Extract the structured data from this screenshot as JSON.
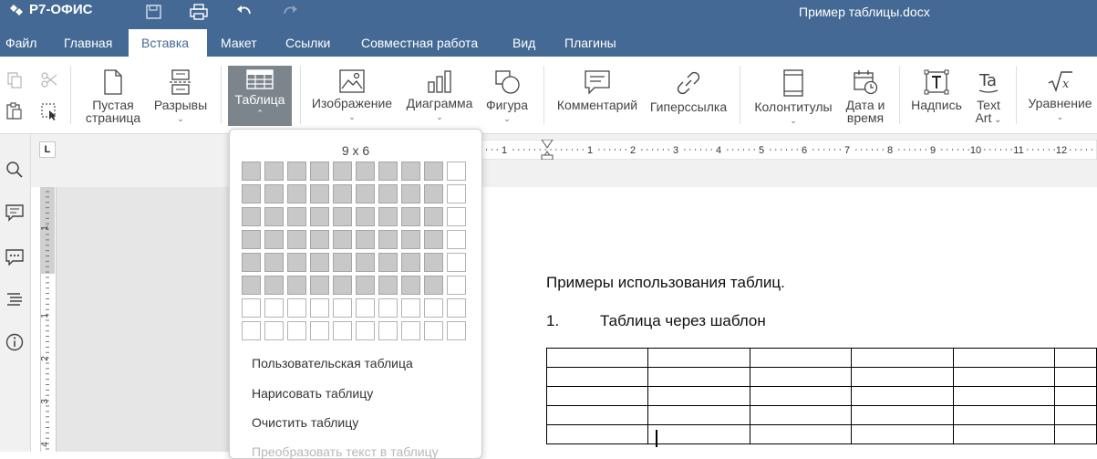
{
  "app": {
    "logo_text": "Р7-ОФИС",
    "document_title": "Пример таблицы.docx"
  },
  "tabs": [
    "Файл",
    "Главная",
    "Вставка",
    "Макет",
    "Ссылки",
    "Совместная работа",
    "Вид",
    "Плагины"
  ],
  "active_tab": "Вставка",
  "toolbar": {
    "blank_page": {
      "line1": "Пустая",
      "line2": "страница"
    },
    "breaks": "Разрывы",
    "table": "Таблица",
    "image": "Изображение",
    "chart": "Диаграмма",
    "shape": "Фигура",
    "comment": "Комментарий",
    "hyperlink": "Гиперссылка",
    "header_footer": "Колонтитулы",
    "date_time": {
      "line1": "Дата и",
      "line2": "время"
    },
    "text_box": "Надпись",
    "text_art": {
      "line1": "Text",
      "line2": "Art"
    },
    "equation": "Уравнение"
  },
  "table_dropdown": {
    "grid_size_label": "9 x 6",
    "grid_columns": 10,
    "grid_rows": 8,
    "selected_columns": 9,
    "selected_rows": 6,
    "menu": {
      "custom_table": "Пользовательская таблица",
      "draw_table": "Нарисовать таблицу",
      "erase_table": "Очистить таблицу",
      "convert_text": "Преобразовать текст в таблицу"
    }
  },
  "ruler": {
    "corner_symbol": "L",
    "numbers": [
      "1",
      "1",
      "2",
      "3",
      "4",
      "5",
      "6",
      "7",
      "8",
      "9",
      "10",
      "11",
      "12"
    ],
    "vertical_numbers": [
      "1",
      "1",
      "2",
      "3",
      "4"
    ]
  },
  "document": {
    "heading": "Примеры использования таблиц.",
    "list_number": "1.",
    "list_text": "Таблица через шаблон",
    "table_rows": 5,
    "table_cols": 6
  },
  "colors": {
    "header_blue": "#446995",
    "pressed_button": "#7d858c",
    "selected_cell": "#c8c8c8"
  }
}
